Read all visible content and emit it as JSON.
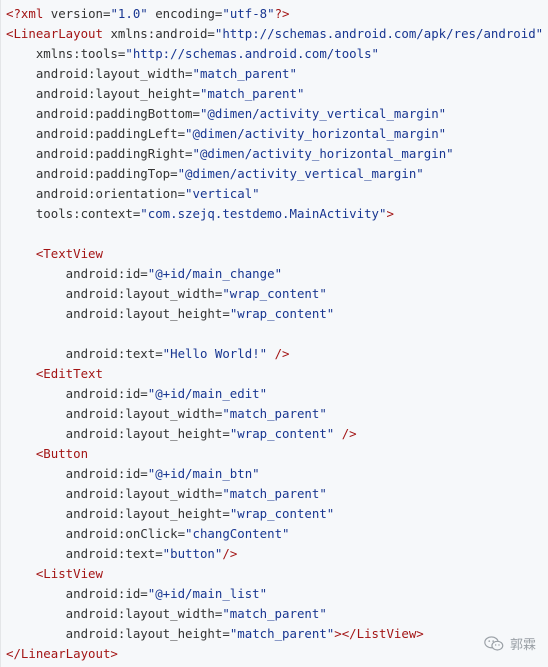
{
  "code": {
    "lines": [
      [
        {
          "t": "pi",
          "v": "<?xml "
        },
        {
          "t": "attr",
          "v": "version"
        },
        {
          "t": "punct",
          "v": "="
        },
        {
          "t": "val",
          "v": "\"1.0\""
        },
        {
          "t": "attr",
          "v": " encoding"
        },
        {
          "t": "punct",
          "v": "="
        },
        {
          "t": "val",
          "v": "\"utf-8\""
        },
        {
          "t": "pi",
          "v": "?>"
        }
      ],
      [
        {
          "t": "tag",
          "v": "<LinearLayout "
        },
        {
          "t": "attr",
          "v": "xmlns:android"
        },
        {
          "t": "punct",
          "v": "="
        },
        {
          "t": "val",
          "v": "\"http://schemas.android.com/apk/res/android\""
        }
      ],
      [
        {
          "t": "attr",
          "v": "    xmlns:tools"
        },
        {
          "t": "punct",
          "v": "="
        },
        {
          "t": "val",
          "v": "\"http://schemas.android.com/tools\""
        }
      ],
      [
        {
          "t": "attr",
          "v": "    android:layout_width"
        },
        {
          "t": "punct",
          "v": "="
        },
        {
          "t": "val",
          "v": "\"match_parent\""
        }
      ],
      [
        {
          "t": "attr",
          "v": "    android:layout_height"
        },
        {
          "t": "punct",
          "v": "="
        },
        {
          "t": "val",
          "v": "\"match_parent\""
        }
      ],
      [
        {
          "t": "attr",
          "v": "    android:paddingBottom"
        },
        {
          "t": "punct",
          "v": "="
        },
        {
          "t": "val",
          "v": "\"@dimen/activity_vertical_margin\""
        }
      ],
      [
        {
          "t": "attr",
          "v": "    android:paddingLeft"
        },
        {
          "t": "punct",
          "v": "="
        },
        {
          "t": "val",
          "v": "\"@dimen/activity_horizontal_margin\""
        }
      ],
      [
        {
          "t": "attr",
          "v": "    android:paddingRight"
        },
        {
          "t": "punct",
          "v": "="
        },
        {
          "t": "val",
          "v": "\"@dimen/activity_horizontal_margin\""
        }
      ],
      [
        {
          "t": "attr",
          "v": "    android:paddingTop"
        },
        {
          "t": "punct",
          "v": "="
        },
        {
          "t": "val",
          "v": "\"@dimen/activity_vertical_margin\""
        }
      ],
      [
        {
          "t": "attr",
          "v": "    android:orientation"
        },
        {
          "t": "punct",
          "v": "="
        },
        {
          "t": "val",
          "v": "\"vertical\""
        }
      ],
      [
        {
          "t": "attr",
          "v": "    tools:context"
        },
        {
          "t": "punct",
          "v": "="
        },
        {
          "t": "val",
          "v": "\"com.szejq.testdemo.MainActivity\""
        },
        {
          "t": "tag",
          "v": ">"
        }
      ],
      [
        {
          "t": "attr",
          "v": ""
        }
      ],
      [
        {
          "t": "tag",
          "v": "    <TextView"
        }
      ],
      [
        {
          "t": "attr",
          "v": "        android:id"
        },
        {
          "t": "punct",
          "v": "="
        },
        {
          "t": "val",
          "v": "\"@+id/main_change\""
        }
      ],
      [
        {
          "t": "attr",
          "v": "        android:layout_width"
        },
        {
          "t": "punct",
          "v": "="
        },
        {
          "t": "val",
          "v": "\"wrap_content\""
        }
      ],
      [
        {
          "t": "attr",
          "v": "        android:layout_height"
        },
        {
          "t": "punct",
          "v": "="
        },
        {
          "t": "val",
          "v": "\"wrap_content\""
        }
      ],
      [
        {
          "t": "attr",
          "v": ""
        }
      ],
      [
        {
          "t": "attr",
          "v": "        android:text"
        },
        {
          "t": "punct",
          "v": "="
        },
        {
          "t": "val",
          "v": "\"Hello World!\""
        },
        {
          "t": "tag",
          "v": " />"
        }
      ],
      [
        {
          "t": "tag",
          "v": "    <EditText"
        }
      ],
      [
        {
          "t": "attr",
          "v": "        android:id"
        },
        {
          "t": "punct",
          "v": "="
        },
        {
          "t": "val",
          "v": "\"@+id/main_edit\""
        }
      ],
      [
        {
          "t": "attr",
          "v": "        android:layout_width"
        },
        {
          "t": "punct",
          "v": "="
        },
        {
          "t": "val",
          "v": "\"match_parent\""
        }
      ],
      [
        {
          "t": "attr",
          "v": "        android:layout_height"
        },
        {
          "t": "punct",
          "v": "="
        },
        {
          "t": "val",
          "v": "\"wrap_content\""
        },
        {
          "t": "tag",
          "v": " />"
        }
      ],
      [
        {
          "t": "tag",
          "v": "    <Button"
        }
      ],
      [
        {
          "t": "attr",
          "v": "        android:id"
        },
        {
          "t": "punct",
          "v": "="
        },
        {
          "t": "val",
          "v": "\"@+id/main_btn\""
        }
      ],
      [
        {
          "t": "attr",
          "v": "        android:layout_width"
        },
        {
          "t": "punct",
          "v": "="
        },
        {
          "t": "val",
          "v": "\"match_parent\""
        }
      ],
      [
        {
          "t": "attr",
          "v": "        android:layout_height"
        },
        {
          "t": "punct",
          "v": "="
        },
        {
          "t": "val",
          "v": "\"wrap_content\""
        }
      ],
      [
        {
          "t": "attr",
          "v": "        android:onClick"
        },
        {
          "t": "punct",
          "v": "="
        },
        {
          "t": "val",
          "v": "\"changContent\""
        }
      ],
      [
        {
          "t": "attr",
          "v": "        android:text"
        },
        {
          "t": "punct",
          "v": "="
        },
        {
          "t": "val",
          "v": "\"button\""
        },
        {
          "t": "tag",
          "v": "/>"
        }
      ],
      [
        {
          "t": "tag",
          "v": "    <ListView"
        }
      ],
      [
        {
          "t": "attr",
          "v": "        android:id"
        },
        {
          "t": "punct",
          "v": "="
        },
        {
          "t": "val",
          "v": "\"@+id/main_list\""
        }
      ],
      [
        {
          "t": "attr",
          "v": "        android:layout_width"
        },
        {
          "t": "punct",
          "v": "="
        },
        {
          "t": "val",
          "v": "\"match_parent\""
        }
      ],
      [
        {
          "t": "attr",
          "v": "        android:layout_height"
        },
        {
          "t": "punct",
          "v": "="
        },
        {
          "t": "val",
          "v": "\"match_parent\""
        },
        {
          "t": "tag",
          "v": "></ListView>"
        }
      ],
      [
        {
          "t": "tag",
          "v": "</LinearLayout>"
        }
      ]
    ]
  },
  "watermark": {
    "text": "郭霖",
    "icon": "wechat-icon"
  },
  "colors": {
    "background": "#f6f8fa",
    "tag": "#a31515",
    "value": "#183691",
    "text": "#333333",
    "watermark": "#9aa0a6"
  }
}
